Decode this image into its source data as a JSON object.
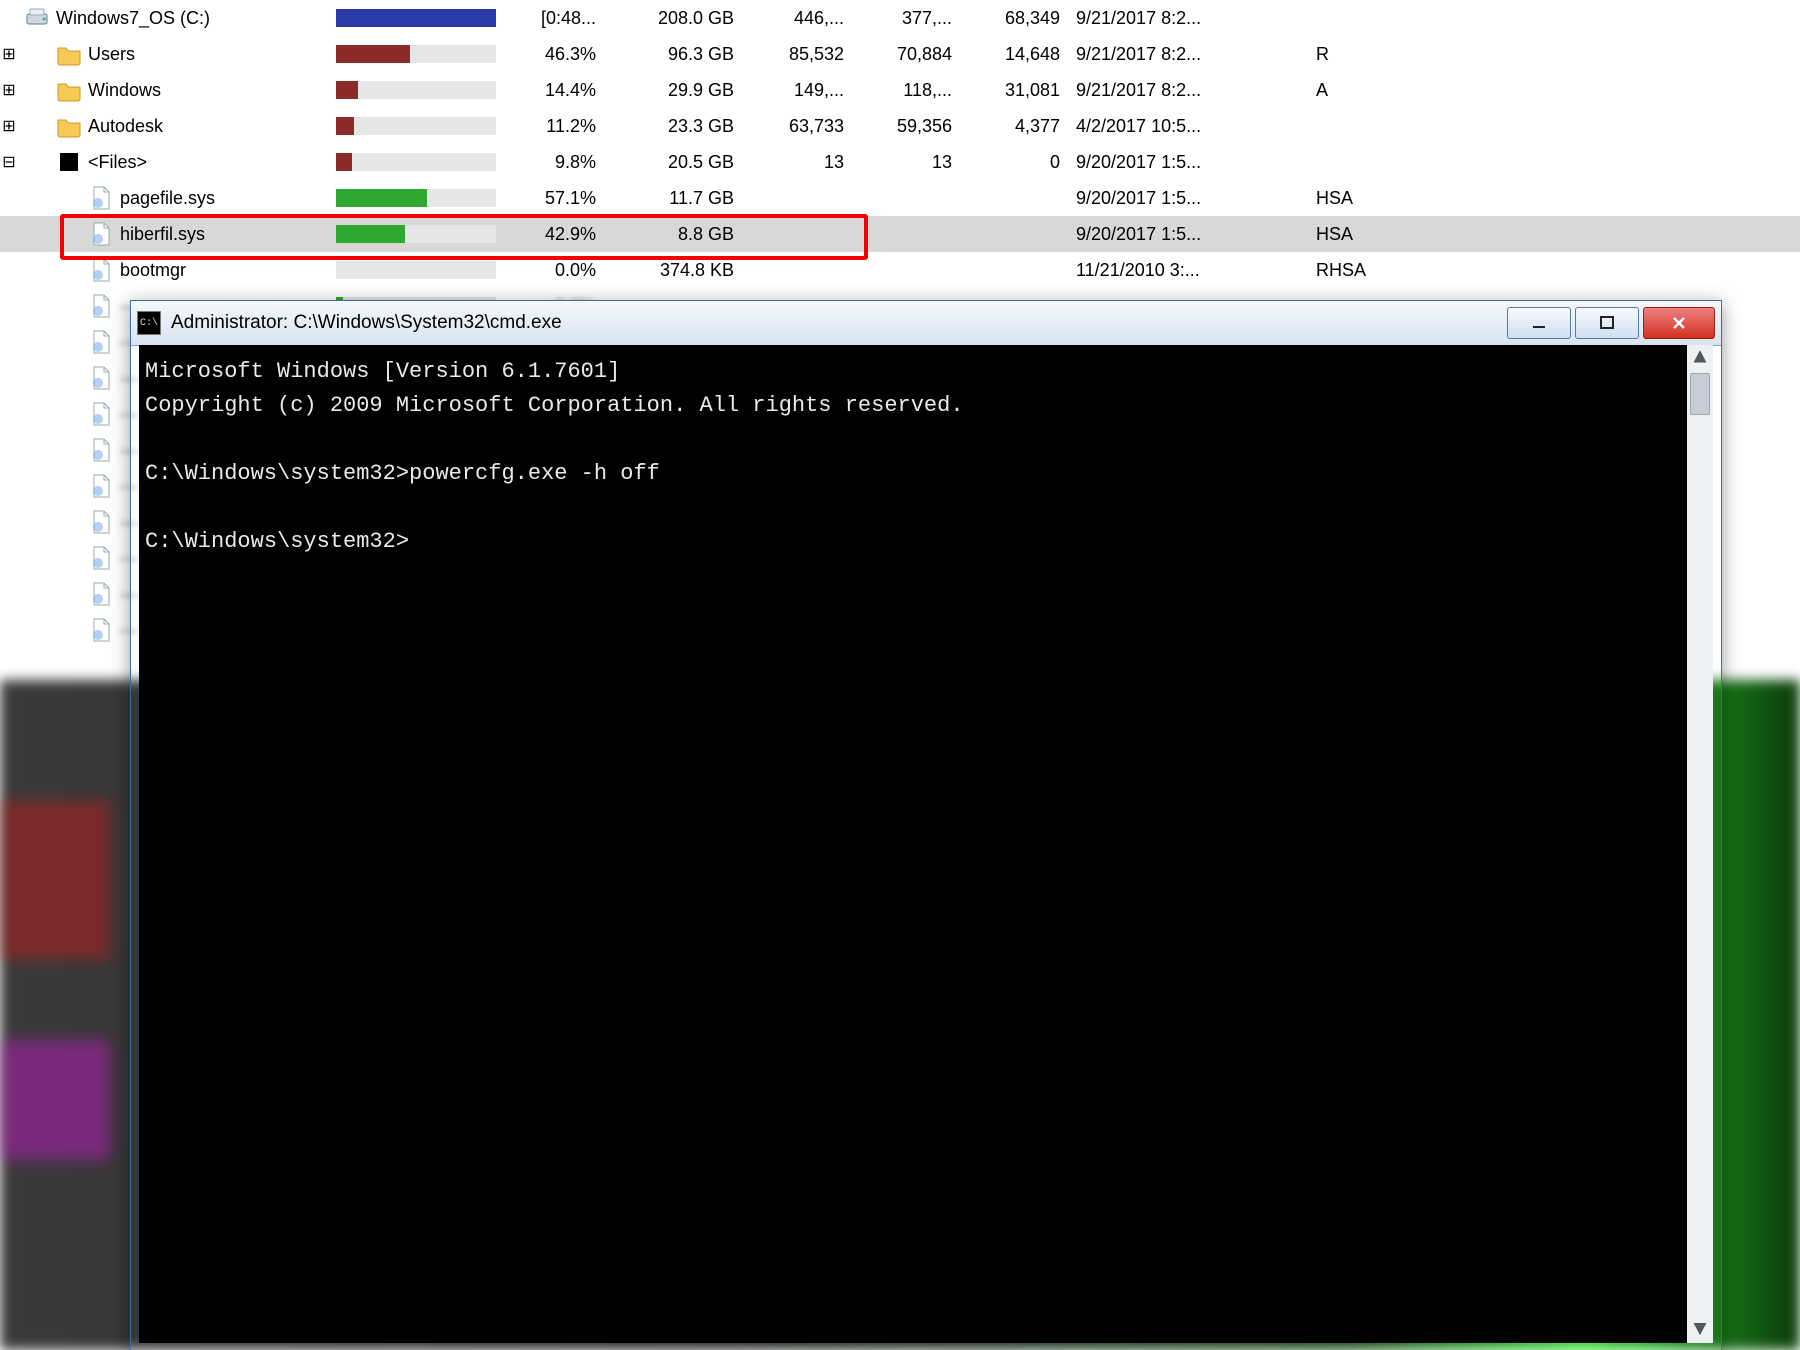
{
  "tree": {
    "rows": [
      {
        "toggle": "leaf",
        "indent": 0,
        "icon": "drive",
        "name": "Windows7_OS (C:)",
        "bar_color": "#2a3aa8",
        "bar_fill": 100,
        "pct": "[0:48...",
        "size": "208.0 GB",
        "n1": "446,...",
        "n2": "377,...",
        "n3": "68,349",
        "date": "9/21/2017  8:2...",
        "attr": "",
        "selected": false
      },
      {
        "toggle": "plus",
        "indent": 1,
        "icon": "folder",
        "name": "Users",
        "bar_color": "#8a2a2a",
        "bar_fill": 46,
        "pct": "46.3%",
        "size": "96.3 GB",
        "n1": "85,532",
        "n2": "70,884",
        "n3": "14,648",
        "date": "9/21/2017  8:2...",
        "attr": "R",
        "selected": false
      },
      {
        "toggle": "plus",
        "indent": 1,
        "icon": "folder",
        "name": "Windows",
        "bar_color": "#8a2a2a",
        "bar_fill": 14,
        "pct": "14.4%",
        "size": "29.9 GB",
        "n1": "149,...",
        "n2": "118,...",
        "n3": "31,081",
        "date": "9/21/2017  8:2...",
        "attr": "A",
        "selected": false
      },
      {
        "toggle": "plus",
        "indent": 1,
        "icon": "folder",
        "name": "Autodesk",
        "bar_color": "#8a2a2a",
        "bar_fill": 11,
        "pct": "11.2%",
        "size": "23.3 GB",
        "n1": "63,733",
        "n2": "59,356",
        "n3": "4,377",
        "date": "4/2/2017  10:5...",
        "attr": "",
        "selected": false
      },
      {
        "toggle": "minus",
        "indent": 1,
        "icon": "blackbox",
        "name": "<Files>",
        "bar_color": "#8a2a2a",
        "bar_fill": 10,
        "pct": "9.8%",
        "size": "20.5 GB",
        "n1": "13",
        "n2": "13",
        "n3": "0",
        "date": "9/20/2017  1:5...",
        "attr": "",
        "selected": false
      },
      {
        "toggle": "leaf",
        "indent": 2,
        "icon": "file",
        "name": "pagefile.sys",
        "bar_color": "#2fa82f",
        "bar_fill": 57,
        "pct": "57.1%",
        "size": "11.7 GB",
        "n1": "",
        "n2": "",
        "n3": "",
        "date": "9/20/2017  1:5...",
        "attr": "HSA",
        "selected": false
      },
      {
        "toggle": "leaf",
        "indent": 2,
        "icon": "file",
        "name": "hiberfil.sys",
        "bar_color": "#2fa82f",
        "bar_fill": 43,
        "pct": "42.9%",
        "size": "8.8 GB",
        "n1": "",
        "n2": "",
        "n3": "",
        "date": "9/20/2017  1:5...",
        "attr": "HSA",
        "selected": true,
        "highlight": true
      },
      {
        "toggle": "leaf",
        "indent": 2,
        "icon": "file",
        "name": "bootmgr",
        "bar_color": "#2fa82f",
        "bar_fill": 0,
        "pct": "0.0%",
        "size": "374.8 KB",
        "n1": "",
        "n2": "",
        "n3": "",
        "date": "11/21/2010  3:...",
        "attr": "RHSA",
        "selected": false
      }
    ]
  },
  "cmd": {
    "title": "Administrator: C:\\Windows\\System32\\cmd.exe",
    "lines": [
      "Microsoft Windows [Version 6.1.7601]",
      "Copyright (c) 2009 Microsoft Corporation.  All rights reserved.",
      "",
      "C:\\Windows\\system32>powercfg.exe -h off",
      "",
      "C:\\Windows\\system32>"
    ]
  }
}
